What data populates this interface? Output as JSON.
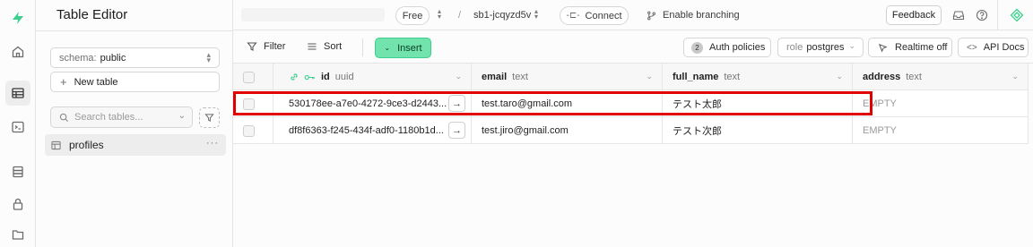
{
  "panel": {
    "title": "Table Editor",
    "schema_label": "schema:",
    "schema_value": "public",
    "new_table_label": "New table",
    "search_placeholder": "Search tables...",
    "tables": [
      {
        "name": "profiles"
      }
    ]
  },
  "topbar": {
    "plan": "Free",
    "separator": "/",
    "project": "sb1-jcqyzd5v",
    "connect_label": "Connect",
    "branching_label": "Enable branching",
    "feedback_label": "Feedback"
  },
  "toolbar": {
    "filter_label": "Filter",
    "sort_label": "Sort",
    "insert_label": "Insert",
    "auth_policies_count": "2",
    "auth_policies_label": "Auth policies",
    "role_label": "role",
    "role_value": "postgres",
    "realtime_label": "Realtime off",
    "api_docs_label": "API Docs"
  },
  "grid": {
    "columns": [
      {
        "name": "id",
        "type": "uuid"
      },
      {
        "name": "email",
        "type": "text"
      },
      {
        "name": "full_name",
        "type": "text"
      },
      {
        "name": "address",
        "type": "text"
      }
    ],
    "rows": [
      {
        "id": "530178ee-a7e0-4272-9ce3-d2443...",
        "email": "test.taro@gmail.com",
        "full_name": "テスト太郎",
        "address": "EMPTY"
      },
      {
        "id": "df8f6363-f245-434f-adf0-1180b1d...",
        "email": "test.jiro@gmail.com",
        "full_name": "テスト次郎",
        "address": "EMPTY"
      }
    ]
  },
  "colors": {
    "accent": "#3ecf8e",
    "insert_bg": "#72e3ad",
    "highlight": "#e00000"
  },
  "icons": [
    "supabase-logo",
    "home-icon",
    "table-icon",
    "sql-icon",
    "database-icon",
    "lock-icon",
    "storage-icon",
    "inbox-icon",
    "help-icon",
    "assistant-icon",
    "filter-icon",
    "sort-icon",
    "link-icon",
    "key-icon",
    "arrow-right-icon"
  ]
}
